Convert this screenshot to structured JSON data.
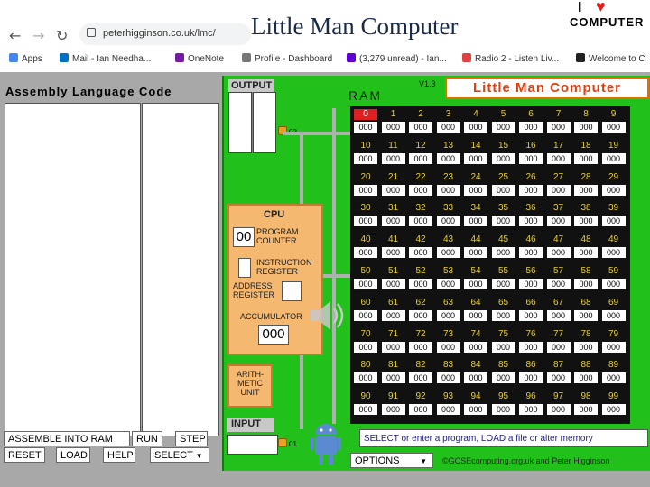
{
  "slide": {
    "title": "Little Man Computer"
  },
  "logo": {
    "line1": "I",
    "line2": "COMPUTER"
  },
  "browser": {
    "url": "peterhigginson.co.uk/lmc/"
  },
  "bookmarks": [
    {
      "label": "Apps",
      "color": "#4285f4"
    },
    {
      "label": "Mail - Ian Needha...",
      "color": "#0072c6"
    },
    {
      "label": "OneNote",
      "color": "#7719aa"
    },
    {
      "label": "Profile - Dashboard",
      "color": "#777777"
    },
    {
      "label": "(3,279 unread) - Ian...",
      "color": "#6001d2"
    },
    {
      "label": "Radio 2 - Listen Liv...",
      "color": "#e04040"
    },
    {
      "label": "Welcome to C",
      "color": "#222222"
    }
  ],
  "lmc": {
    "asm_title": "Assembly Language Code",
    "output_label": "OUTPUT",
    "pin_output": "02",
    "pin_input": "01",
    "cpu": {
      "title": "CPU",
      "pc_label": "PROGRAM COUNTER",
      "pc_value": "00",
      "ir_label": "INSTRUCTION REGISTER",
      "ar_label": "ADDRESS REGISTER",
      "acc_label": "ACCUMULATOR",
      "acc_value": "000"
    },
    "alu_label": "ARITH-METIC UNIT",
    "input_label": "INPUT",
    "ram_label": "RAM",
    "version": "V1.3",
    "banner": "Little Man Computer",
    "message": "SELECT or enter a program, LOAD a file or alter memory",
    "options_label": "OPTIONS",
    "credit": "©GCSEcomputing.org.uk and Peter Higginson",
    "buttons": {
      "assemble": "ASSEMBLE INTO RAM",
      "run": "RUN",
      "step": "STEP",
      "reset": "RESET",
      "load": "LOAD",
      "help": "HELP",
      "select": "SELECT"
    },
    "ram_default": "000",
    "selected_address": 0
  }
}
